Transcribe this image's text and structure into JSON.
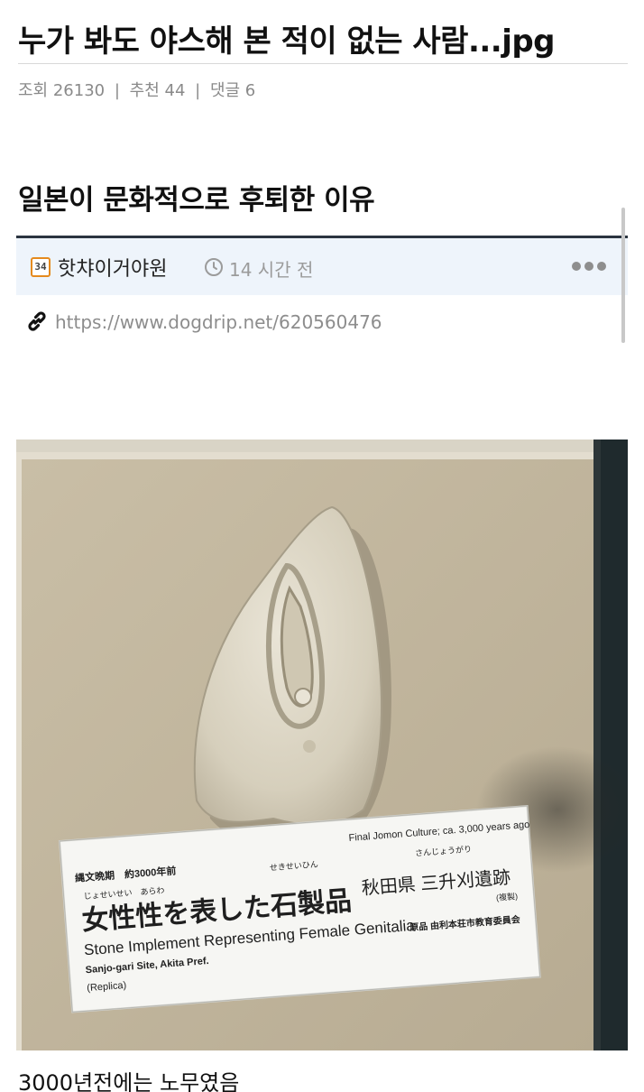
{
  "post": {
    "title": "누가 봐도 야스해 본 적이 없는 사람...jpg",
    "views": "조회 26130",
    "recommends": "추천 44",
    "comments": "댓글 6",
    "separator": "|"
  },
  "embed": {
    "heading": "일본이 문화적으로 후퇴한 이유",
    "author": {
      "badge": "34",
      "name": "핫챠이거야원",
      "badge_color": "#e58a1e"
    },
    "time_ago": "14 시간 전",
    "source_url": "https://www.dogdrip.net/620560476",
    "icons": {
      "clock": "clock-icon",
      "more": "more-options-icon",
      "link": "link-icon"
    }
  },
  "photo": {
    "label": {
      "top_right": "Final Jomon Culture; ca. 3,000 years ago",
      "period_jp": "縄文晩期　約3000年前",
      "furigana_1": "じょせいせい　あらわ",
      "furigana_2": "せきせいひん",
      "furigana_3": "さんじょうがり",
      "title_jp": "女性性を表した石製品",
      "location_jp": "秋田県 三升刈遺跡",
      "replica_jp": "(複製)",
      "english_title": "Stone Implement Representing Female Genitalia",
      "site_en": "Sanjo-gari Site, Akita Pref.",
      "replica_en": "(Replica)",
      "owner_jp": "原品 由利本荘市教育委員会"
    }
  },
  "caption": "3000년전에는 노무였음"
}
